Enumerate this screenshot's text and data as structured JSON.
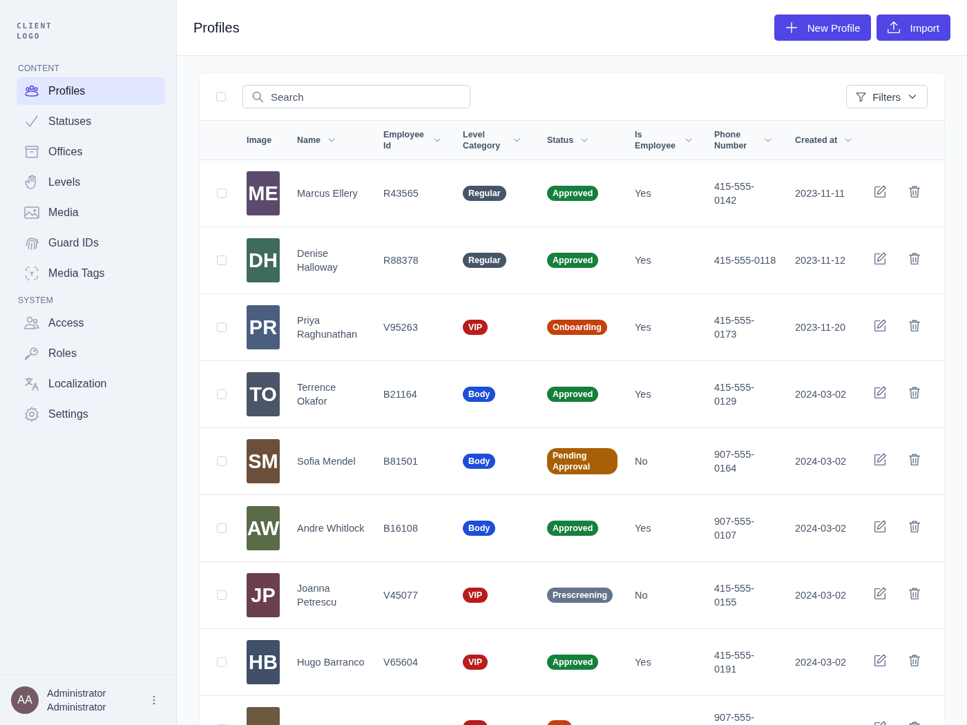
{
  "sidebar": {
    "logo": "CLIENT LOGO",
    "sections": [
      {
        "title": "CONTENT",
        "items": [
          {
            "label": "Profiles",
            "selected": true
          },
          {
            "label": "Statuses",
            "selected": false
          },
          {
            "label": "Offices",
            "selected": false
          },
          {
            "label": "Levels",
            "selected": false
          },
          {
            "label": "Media",
            "selected": false
          },
          {
            "label": "Guard IDs",
            "selected": false
          },
          {
            "label": "Media Tags",
            "selected": false
          }
        ]
      },
      {
        "title": "SYSTEM",
        "items": [
          {
            "label": "Access",
            "selected": false
          },
          {
            "label": "Roles",
            "selected": false
          },
          {
            "label": "Localization",
            "selected": false
          },
          {
            "label": "Settings",
            "selected": false
          }
        ]
      }
    ],
    "user": {
      "initials": "AA",
      "name": "Administrator Administrator"
    }
  },
  "header": {
    "title": "Profiles",
    "buttons": [
      {
        "label": "New Profile",
        "kind": "add"
      },
      {
        "label": "Import",
        "kind": "upload"
      }
    ]
  },
  "table": {
    "select_all_checked": false,
    "search": {
      "placeholder": "Search"
    },
    "filters": "Filters",
    "columns": [
      "Image",
      "Name",
      "Employee Id",
      "Level Category",
      "Status",
      "Is Employee",
      "Phone Number",
      "Created at"
    ],
    "rows": [
      {
        "checked": false,
        "initials": "ME",
        "color": "#5b4a6b",
        "name": "Marcus Ellery",
        "employee_id": "R43565",
        "level": {
          "kind": "regular",
          "label": "Regular"
        },
        "status": {
          "kind": "approved",
          "label": "Approved"
        },
        "is_employee": "Yes",
        "phone": "415-555-0142",
        "created": "2023-11-11"
      },
      {
        "checked": false,
        "initials": "DH",
        "color": "#3e6b5c",
        "name": "Denise Halloway",
        "employee_id": "R88378",
        "level": {
          "kind": "regular",
          "label": "Regular"
        },
        "status": {
          "kind": "approved",
          "label": "Approved"
        },
        "is_employee": "Yes",
        "phone": "415-555-0118",
        "created": "2023-11-12"
      },
      {
        "checked": false,
        "initials": "PR",
        "color": "#4a5f80",
        "name": "Priya Raghunathan",
        "employee_id": "V95263",
        "level": {
          "kind": "vip",
          "label": "VIP"
        },
        "status": {
          "kind": "onboarding",
          "label": "Onboarding"
        },
        "is_employee": "Yes",
        "phone": "415-555-0173",
        "created": "2023-11-20"
      },
      {
        "checked": false,
        "initials": "TO",
        "color": "#4a5568",
        "name": "Terrence Okafor",
        "employee_id": "B21164",
        "level": {
          "kind": "body",
          "label": "Body"
        },
        "status": {
          "kind": "approved",
          "label": "Approved"
        },
        "is_employee": "Yes",
        "phone": "415-555-0129",
        "created": "2024-03-02"
      },
      {
        "checked": false,
        "initials": "SM",
        "color": "#6b4f3a",
        "name": "Sofia Mendel",
        "employee_id": "B81501",
        "level": {
          "kind": "body",
          "label": "Body"
        },
        "status": {
          "kind": "pending",
          "label": "Pending Approval"
        },
        "is_employee": "No",
        "phone": "907-555-0164",
        "created": "2024-03-02"
      },
      {
        "checked": false,
        "initials": "AW",
        "color": "#5a6b47",
        "name": "Andre Whitlock",
        "employee_id": "B16108",
        "level": {
          "kind": "body",
          "label": "Body"
        },
        "status": {
          "kind": "approved",
          "label": "Approved"
        },
        "is_employee": "Yes",
        "phone": "907-555-0107",
        "created": "2024-03-02"
      },
      {
        "checked": false,
        "initials": "JP",
        "color": "#6b3f4f",
        "name": "Joanna Petrescu",
        "employee_id": "V45077",
        "level": {
          "kind": "vip",
          "label": "VIP"
        },
        "status": {
          "kind": "prescreening",
          "label": "Prescreening"
        },
        "is_employee": "No",
        "phone": "415-555-0155",
        "created": "2024-03-02"
      },
      {
        "checked": false,
        "initials": "HB",
        "color": "#3f5068",
        "name": "Hugo Barranco",
        "employee_id": "V65604",
        "level": {
          "kind": "vip",
          "label": "VIP"
        },
        "status": {
          "kind": "approved",
          "label": "Approved"
        },
        "is_employee": "Yes",
        "phone": "415-555-0191",
        "created": "2024-03-02"
      },
      {
        "checked": false,
        "color": "#6b5a3f",
        "level": {
          "kind": "vip"
        },
        "status": {
          "kind": "onboarding"
        },
        "phone": "907-555-"
      }
    ]
  }
}
